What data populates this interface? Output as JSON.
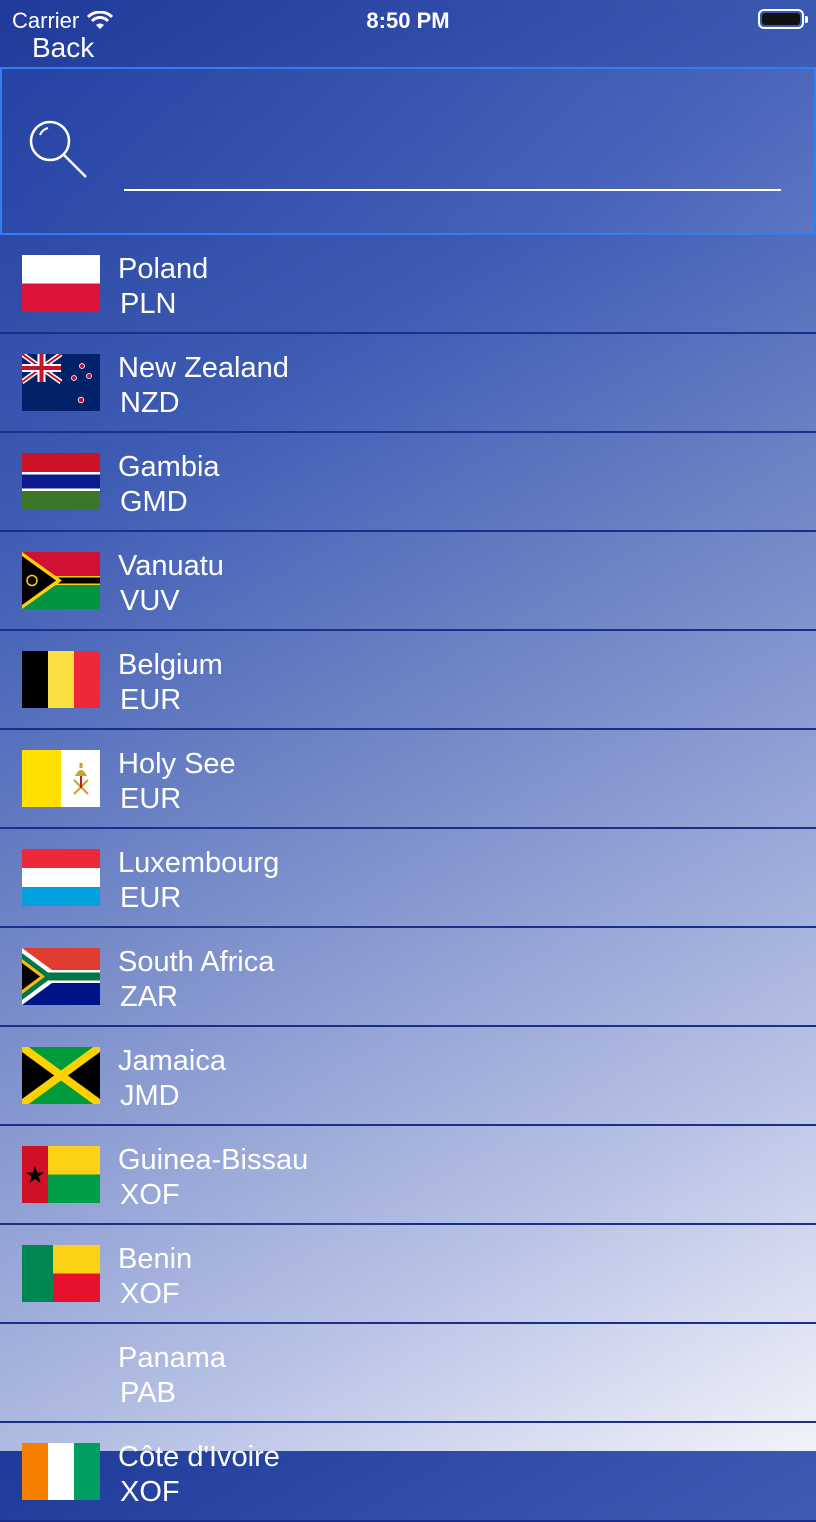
{
  "status_bar": {
    "carrier": "Carrier",
    "time": "8:50 PM"
  },
  "nav": {
    "back_label": "Back"
  },
  "search": {
    "placeholder": "",
    "value": ""
  },
  "countries": [
    {
      "name": "Poland",
      "code": "PLN",
      "flag": "poland-flag"
    },
    {
      "name": "New Zealand",
      "code": "NZD",
      "flag": "new-zealand-flag"
    },
    {
      "name": "Gambia",
      "code": "GMD",
      "flag": "gambia-flag"
    },
    {
      "name": "Vanuatu",
      "code": "VUV",
      "flag": "vanuatu-flag"
    },
    {
      "name": "Belgium",
      "code": "EUR",
      "flag": "belgium-flag"
    },
    {
      "name": "Holy See",
      "code": "EUR",
      "flag": "holy-see-flag"
    },
    {
      "name": "Luxembourg",
      "code": "EUR",
      "flag": "luxembourg-flag"
    },
    {
      "name": "South Africa",
      "code": "ZAR",
      "flag": "south-africa-flag"
    },
    {
      "name": "Jamaica",
      "code": "JMD",
      "flag": "jamaica-flag"
    },
    {
      "name": "Guinea-Bissau",
      "code": "XOF",
      "flag": "guinea-bissau-flag"
    },
    {
      "name": "Benin",
      "code": "XOF",
      "flag": "benin-flag"
    },
    {
      "name": "Panama",
      "code": "PAB",
      "flag": "none"
    },
    {
      "name": "Côte d'Ivoire",
      "code": "XOF",
      "flag": "cote-divoire-flag"
    }
  ]
}
